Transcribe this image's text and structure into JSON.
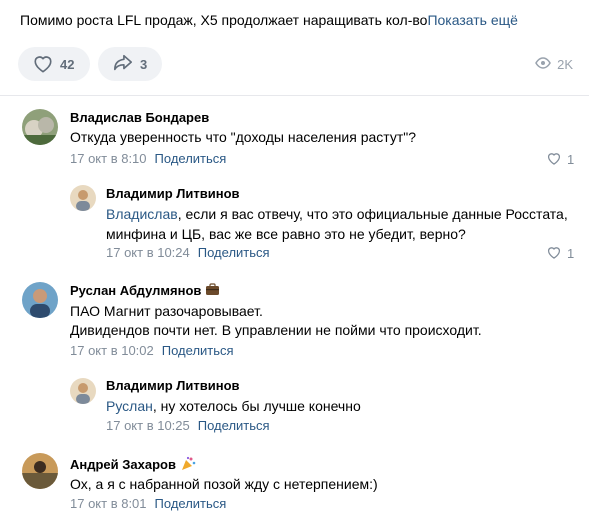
{
  "post": {
    "text": "Помимо роста LFL продаж, X5 продолжает наращивать кол-во",
    "more_label": "Показать ещё",
    "likes": "42",
    "shares": "3",
    "views": "2K"
  },
  "comments": [
    {
      "author": "Владислав Бондарев",
      "text": "Откуда уверенность что \"доходы населения растут\"?",
      "date": "17 окт в 8:10",
      "share_label": "Поделиться",
      "likes": "1"
    },
    {
      "author": "Владимир Литвинов",
      "mention": "Владислав",
      "text_line1": ", если я вас отвечу, что это официальные данные Росстата,",
      "text_line2": "минфина и ЦБ, вас же все равно это не убедит, верно?",
      "date": "17 окт в 10:24",
      "share_label": "Поделиться",
      "likes": "1"
    },
    {
      "author": "Руслан Абдулмянов",
      "text_line1": "ПАО Магнит разочаровывает.",
      "text_line2": "Дивидендов почти нет. В управлении не пойми что происходит.",
      "date": "17 окт в 10:02",
      "share_label": "Поделиться"
    },
    {
      "author": "Владимир Литвинов",
      "mention": "Руслан",
      "text": ", ну хотелось бы лучше конечно",
      "date": "17 окт в 10:25",
      "share_label": "Поделиться"
    },
    {
      "author": "Андрей Захаров",
      "text": "Ох, а я с набранной позой жду с нетерпением:)",
      "date": "17 окт в 8:01",
      "share_label": "Поделиться"
    }
  ],
  "colors": {
    "link": "#2a5885",
    "meta": "#818c99",
    "pill_bg": "#f0f2f5"
  }
}
